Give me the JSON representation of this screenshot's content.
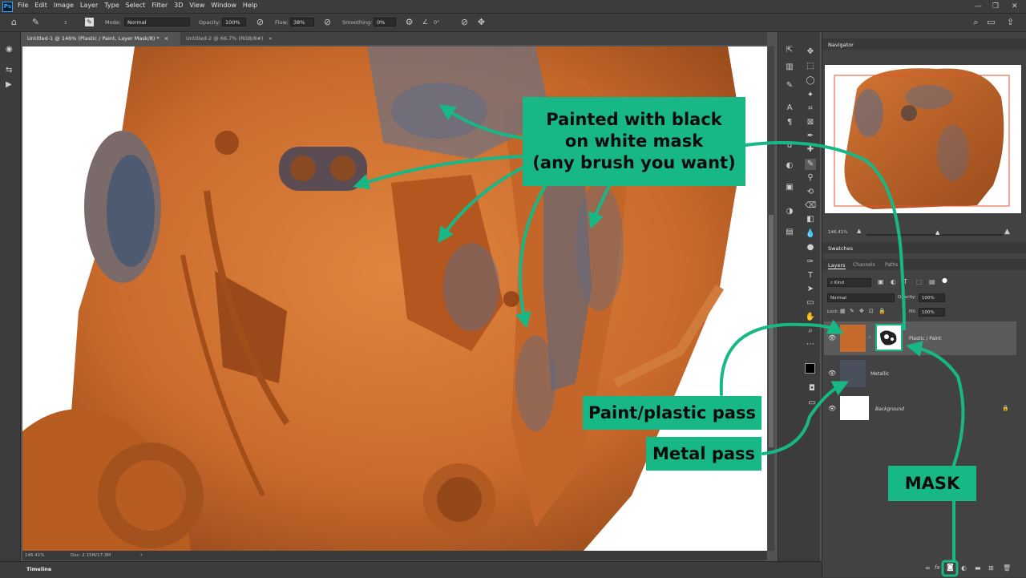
{
  "app": {
    "logo": "Ps"
  },
  "menu": [
    "File",
    "Edit",
    "Image",
    "Layer",
    "Type",
    "Select",
    "Filter",
    "3D",
    "View",
    "Window",
    "Help"
  ],
  "window_controls": {
    "minimize": "—",
    "maximize": "❐",
    "close": "✕"
  },
  "options": {
    "mode_label": "Mode:",
    "mode_value": "Normal",
    "opacity_label": "Opacity:",
    "opacity_value": "100%",
    "flow_label": "Flow:",
    "flow_value": "38%",
    "smoothing_label": "Smoothing:",
    "smoothing_value": "0%",
    "angle_value": "0°",
    "brush_size": "3"
  },
  "tabs": [
    {
      "label": "Untitled-1 @ 146% (Plastic / Paint, Layer Mask/8) *",
      "close": "×"
    },
    {
      "label": "Untitled-2 @ 66.7% (RGB/8#)",
      "close": "×"
    }
  ],
  "status": {
    "zoom": "146.41%",
    "doc": "Doc: 2.15M/17.3M",
    "arrow": "›"
  },
  "timeline": {
    "label": "Timeline"
  },
  "navigator": {
    "title": "Navigator",
    "zoom": "146.41%"
  },
  "swatches": {
    "title": "Swatches"
  },
  "layers_panel": {
    "tabs": [
      "Layers",
      "Channels",
      "Paths"
    ],
    "filter": "Kind",
    "blend": "Normal",
    "opacity_label": "Opacity:",
    "opacity_value": "100%",
    "lock_label": "Lock:",
    "fill_label": "Fill:",
    "fill_value": "100%",
    "layers": [
      {
        "name": "Plastic / Paint",
        "selected": true
      },
      {
        "name": "Metallic",
        "selected": false
      },
      {
        "name": "Background",
        "selected": false,
        "locked": true
      }
    ],
    "footer_icons": [
      "link-icon",
      "fx-icon",
      "mask-icon",
      "adjustment-icon",
      "folder-icon",
      "new-layer-icon",
      "trash-icon"
    ]
  },
  "annotations": {
    "painted": [
      "Painted with black",
      "on white mask",
      "(any brush you want)"
    ],
    "paint_pass": "Paint/plastic pass",
    "metal_pass": "Metal pass",
    "mask": "MASK"
  },
  "colors": {
    "accent": "#17b886",
    "orange": "#c96a2c",
    "ui_dark": "#3c3c3c"
  }
}
